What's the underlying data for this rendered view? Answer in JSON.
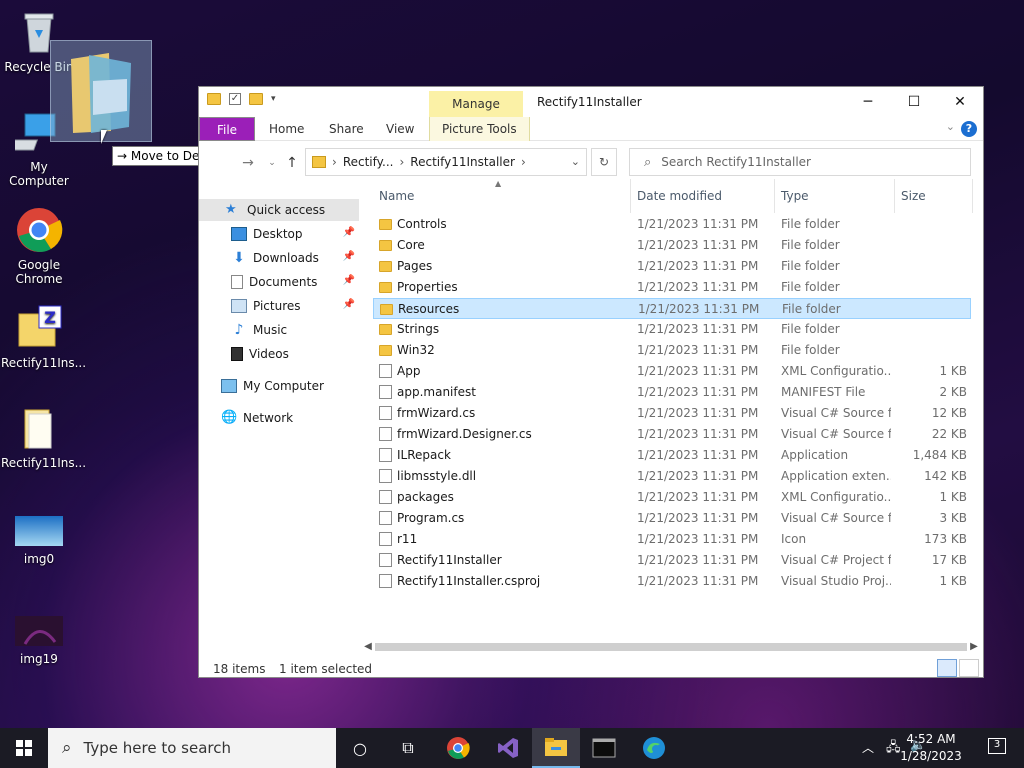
{
  "desktop": {
    "icons": [
      {
        "label": "Recycle Bin"
      },
      {
        "label": "My Computer"
      },
      {
        "label": "Google Chrome"
      },
      {
        "label": "Rectify11Ins..."
      },
      {
        "label": "Rectify11Ins..."
      },
      {
        "label": "img0"
      },
      {
        "label": "img19"
      }
    ],
    "drag_tooltip": "→ Move to Desktop"
  },
  "window": {
    "title": "Rectify11Installer",
    "contextual_tab_group": "Manage",
    "ribbon_tabs": [
      "File",
      "Home",
      "Share",
      "View",
      "Picture Tools"
    ],
    "controls": {
      "minimize": "─",
      "maximize": "☐",
      "close": "✕"
    },
    "breadcrumb": [
      "Rectify...",
      "Rectify11Installer"
    ],
    "search_placeholder": "Search Rectify11Installer",
    "columns": [
      "Name",
      "Date modified",
      "Type",
      "Size"
    ],
    "nav": {
      "quick_access": "Quick access",
      "items": [
        {
          "label": "Desktop",
          "pinned": true
        },
        {
          "label": "Downloads",
          "pinned": true
        },
        {
          "label": "Documents",
          "pinned": true
        },
        {
          "label": "Pictures",
          "pinned": true
        },
        {
          "label": "Music",
          "pinned": false
        },
        {
          "label": "Videos",
          "pinned": false
        }
      ],
      "my_computer": "My Computer",
      "network": "Network"
    },
    "files": [
      {
        "name": "Controls",
        "date": "1/21/2023 11:31 PM",
        "type": "File folder",
        "size": "",
        "kind": "folder"
      },
      {
        "name": "Core",
        "date": "1/21/2023 11:31 PM",
        "type": "File folder",
        "size": "",
        "kind": "folder"
      },
      {
        "name": "Pages",
        "date": "1/21/2023 11:31 PM",
        "type": "File folder",
        "size": "",
        "kind": "folder"
      },
      {
        "name": "Properties",
        "date": "1/21/2023 11:31 PM",
        "type": "File folder",
        "size": "",
        "kind": "folder"
      },
      {
        "name": "Resources",
        "date": "1/21/2023 11:31 PM",
        "type": "File folder",
        "size": "",
        "kind": "folder",
        "selected": true
      },
      {
        "name": "Strings",
        "date": "1/21/2023 11:31 PM",
        "type": "File folder",
        "size": "",
        "kind": "folder"
      },
      {
        "name": "Win32",
        "date": "1/21/2023 11:31 PM",
        "type": "File folder",
        "size": "",
        "kind": "folder"
      },
      {
        "name": "App",
        "date": "1/21/2023 11:31 PM",
        "type": "XML Configuratio...",
        "size": "1 KB",
        "kind": "file"
      },
      {
        "name": "app.manifest",
        "date": "1/21/2023 11:31 PM",
        "type": "MANIFEST File",
        "size": "2 KB",
        "kind": "file"
      },
      {
        "name": "frmWizard.cs",
        "date": "1/21/2023 11:31 PM",
        "type": "Visual C# Source f...",
        "size": "12 KB",
        "kind": "file"
      },
      {
        "name": "frmWizard.Designer.cs",
        "date": "1/21/2023 11:31 PM",
        "type": "Visual C# Source f...",
        "size": "22 KB",
        "kind": "file"
      },
      {
        "name": "ILRepack",
        "date": "1/21/2023 11:31 PM",
        "type": "Application",
        "size": "1,484 KB",
        "kind": "file"
      },
      {
        "name": "libmsstyle.dll",
        "date": "1/21/2023 11:31 PM",
        "type": "Application exten...",
        "size": "142 KB",
        "kind": "file"
      },
      {
        "name": "packages",
        "date": "1/21/2023 11:31 PM",
        "type": "XML Configuratio...",
        "size": "1 KB",
        "kind": "file"
      },
      {
        "name": "Program.cs",
        "date": "1/21/2023 11:31 PM",
        "type": "Visual C# Source f...",
        "size": "3 KB",
        "kind": "file"
      },
      {
        "name": "r11",
        "date": "1/21/2023 11:31 PM",
        "type": "Icon",
        "size": "173 KB",
        "kind": "file"
      },
      {
        "name": "Rectify11Installer",
        "date": "1/21/2023 11:31 PM",
        "type": "Visual C# Project f...",
        "size": "17 KB",
        "kind": "file"
      },
      {
        "name": "Rectify11Installer.csproj",
        "date": "1/21/2023 11:31 PM",
        "type": "Visual Studio Proj...",
        "size": "1 KB",
        "kind": "file"
      }
    ],
    "status": {
      "count": "18 items",
      "selected": "1 item selected"
    }
  },
  "taskbar": {
    "search_placeholder": "Type here to search",
    "time": "4:52 AM",
    "date": "1/28/2023",
    "notifications": "3"
  },
  "colors": {
    "file_tab": "#9b1fb8",
    "manage_tab": "#fbf1a6",
    "selection": "#cce8ff",
    "accent": "#1b6ed1"
  }
}
